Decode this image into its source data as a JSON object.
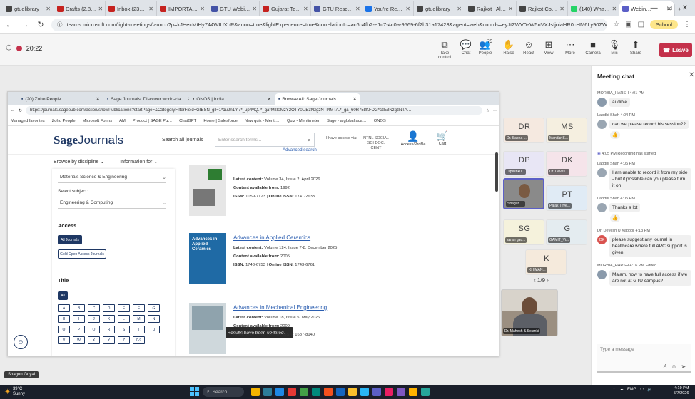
{
  "chrome": {
    "tabs": [
      {
        "label": "gtuelibrary",
        "color": "#444"
      },
      {
        "label": "Drafts (2,8…",
        "color": "#c5221f"
      },
      {
        "label": "Inbox (23…",
        "color": "#c5221f"
      },
      {
        "label": "IMPORTA…",
        "color": "#c5221f"
      },
      {
        "label": "GTU Webi…",
        "color": "#4453a6"
      },
      {
        "label": "Gujarat Te…",
        "color": "#c5221f"
      },
      {
        "label": "GTU Reso…",
        "color": "#4453a6"
      },
      {
        "label": "You're Re…",
        "color": "#1a73e8"
      },
      {
        "label": "gtuelibrary",
        "color": "#444"
      },
      {
        "label": "Rajkot | Al…",
        "color": "#444"
      },
      {
        "label": "Rajkot Co…",
        "color": "#444"
      },
      {
        "label": "(140) Wha…",
        "color": "#25d366"
      },
      {
        "label": "Webin…",
        "color": "#5b5fc7"
      }
    ],
    "new_tab": "+",
    "url": "teams.microsoft.com/light-meetings/launch?p=kJHecMtHy744WIUXnR&anon=true&lightExperience=true&correlationId=ac6b4fb2-e1c7-4c0a-9569-6f2b31a17423&agent=web&coords=eyJtZWV0aW5nVXJsIjoiaHR0cHM6Ly90ZW...",
    "profile_label": "School"
  },
  "teams": {
    "recording_time": "20:22",
    "toolbar": [
      {
        "label": "Take control",
        "icon": "⧉"
      },
      {
        "label": "Chat",
        "icon": "💬"
      },
      {
        "label": "People",
        "icon": "👥"
      },
      {
        "label": "Raise",
        "icon": "✋"
      },
      {
        "label": "React",
        "icon": "☺"
      },
      {
        "label": "View",
        "icon": "⊞"
      },
      {
        "label": "More",
        "icon": "⋯"
      }
    ],
    "people_count": "75",
    "devices": [
      {
        "label": "Camera",
        "icon": "■"
      },
      {
        "label": "Mic",
        "icon": "🎙"
      },
      {
        "label": "Share",
        "icon": "⬆"
      }
    ],
    "leave_label": "Leave"
  },
  "inner_browser": {
    "tabs": [
      {
        "label": "(20) Zoho People"
      },
      {
        "label": "Sage Journals: Discover world-cla…"
      },
      {
        "label": "ONOS | India"
      },
      {
        "label": "Browse All: Sage Journals"
      }
    ],
    "url": "https://journals.sagepub.com/action/showPublications?startPage=&CategoryFilterField=GIBSN_gll=1*1u2n1m7*_up*MQ..*_ga*MzI0MzY2OTY0LjE3NzgzNTI4MTA.*_ga_60R758KFDG*czE3NzgzNTA…",
    "bookmarks": [
      "Managed favorites",
      "Zoho People",
      "Microsoft Forms",
      "AM",
      "Product | SAGE Pu…",
      "ChatGPT",
      "Home | Salesforce",
      "New quiz - Menti…",
      "Quiz - Mentimeter",
      "Sage - a global aca…",
      "ONOS"
    ]
  },
  "sage": {
    "logo_a": "Sage",
    "logo_b": "Journals",
    "all_journals": "Search all journals",
    "search_placeholder": "Enter search terms...",
    "advanced_search": "Advanced search",
    "access_via": "I have access via:",
    "institution": "NTNL SOCIAL SCI DOC. CENT",
    "account": "Access/Profile",
    "cart": "Cart",
    "nav": [
      "Browse by discipline",
      "Information for"
    ],
    "filters": {
      "selected_discipline": "Materials Science & Engineering",
      "subject_label": "Select subject:",
      "selected_subject": "Engineering & Computing",
      "access_heading": "Access",
      "all_journals_btn": "All Journals",
      "gold_oa_btn": "Gold Open Access Journals",
      "title_heading": "Title",
      "all_btn": "All",
      "letters": [
        "A",
        "B",
        "C",
        "D",
        "E",
        "F",
        "G",
        "H",
        "I",
        "J",
        "K",
        "L",
        "M",
        "N",
        "O",
        "P",
        "Q",
        "R",
        "S",
        "T",
        "U",
        "V",
        "W",
        "X",
        "Y",
        "Z",
        "0-9"
      ]
    },
    "results": [
      {
        "title": "Adaptive Behavior",
        "latest": "Volume 34, Issue 2, April 2026",
        "available": "1992",
        "issn": "1059-7123",
        "online_issn": "1741-2633",
        "cover": "#e6e6e6"
      },
      {
        "title": "Advances in Applied Ceramics",
        "latest": "Volume 124, Issue 7-8, December 2025",
        "available": "2005",
        "issn": "1743-6753",
        "online_issn": "1743-6761",
        "cover": "#1f6aa5"
      },
      {
        "title": "Advances in Mechanical Engineering",
        "latest": "Volume 18, Issue 5, May 2026",
        "available": "2009",
        "issn": "1687-8132",
        "online_issn": "1687-8140",
        "cover": "#cfd8dc"
      }
    ],
    "labels": {
      "latest": "Latest content:",
      "available": "Content available from:",
      "issn": "ISSN:",
      "online_issn": "Online ISSN:"
    },
    "toast": "Results have been updated."
  },
  "participants": [
    {
      "initials": "DR",
      "name": "Dr. Sapna ...",
      "color": "#f5e9e0"
    },
    {
      "initials": "MS",
      "name": "Mandar S...",
      "color": "#f5efe0"
    },
    {
      "initials": "DP",
      "name": "Dipeshku...",
      "color": "#e8e6f5"
    },
    {
      "initials": "DK",
      "name": "Dr. Deves...",
      "color": "#f5e4ea"
    },
    {
      "initials": "",
      "name": "Shagun ...",
      "color": "#8a8a8a"
    },
    {
      "initials": "PT",
      "name": "Palak Trive...",
      "color": "#e0ebf5"
    },
    {
      "initials": "SG",
      "name": "sarah gad...",
      "color": "#f5f2dc"
    },
    {
      "initials": "G",
      "name": "GAMIT_Vi...",
      "color": "#e4ecf0"
    },
    {
      "initials": "K",
      "name": "KHIMAN...",
      "color": "#f5eadc"
    }
  ],
  "pager": "1/9",
  "speaker_name": "Dr. Mahesh & Solanki",
  "self_tag": "Shagun Goyal",
  "chat": {
    "title": "Meeting chat",
    "input_placeholder": "Type a message",
    "messages": [
      {
        "sender": "MORBIA_HARSH",
        "time": "4:01 PM",
        "text": "audible",
        "avatar": "#8a9aab"
      },
      {
        "sender": "Labdhi Shah",
        "time": "4:04 PM",
        "text": "can we please record his session??",
        "avatar": "#9aa6b2",
        "react": "👍"
      },
      {
        "sender": "",
        "time": "4:05 PM",
        "text": "Recording has started",
        "system": true
      },
      {
        "sender": "Labdhi Shah",
        "time": "4:05 PM",
        "text": "I am unable to record it from my side - but if possible can you please turn it on",
        "avatar": "#9aa6b2"
      },
      {
        "sender": "Labdhi Shah",
        "time": "4:05 PM",
        "text": "Thanks a lot",
        "avatar": "#9aa6b2",
        "react": "👍"
      },
      {
        "sender": "Dr. Devesh U Kapoor",
        "time": "4:13 PM",
        "text": "please suggest any journal in healthcare where full APC support is given.",
        "avatar": "#d9534f",
        "avatar_text": "DK"
      },
      {
        "sender": "MORBIA_HARSH",
        "time": "4:16 PM",
        "text": "Ma'am, how to have full access if we are not at GTU campus?",
        "avatar": "#8a9aab",
        "edited": "Edited"
      }
    ]
  },
  "taskbar": {
    "temp": "39°C",
    "weather": "Sunny",
    "search": "Search",
    "lang": "ENG",
    "time": "4:19 PM",
    "date": "5/7/2026"
  }
}
